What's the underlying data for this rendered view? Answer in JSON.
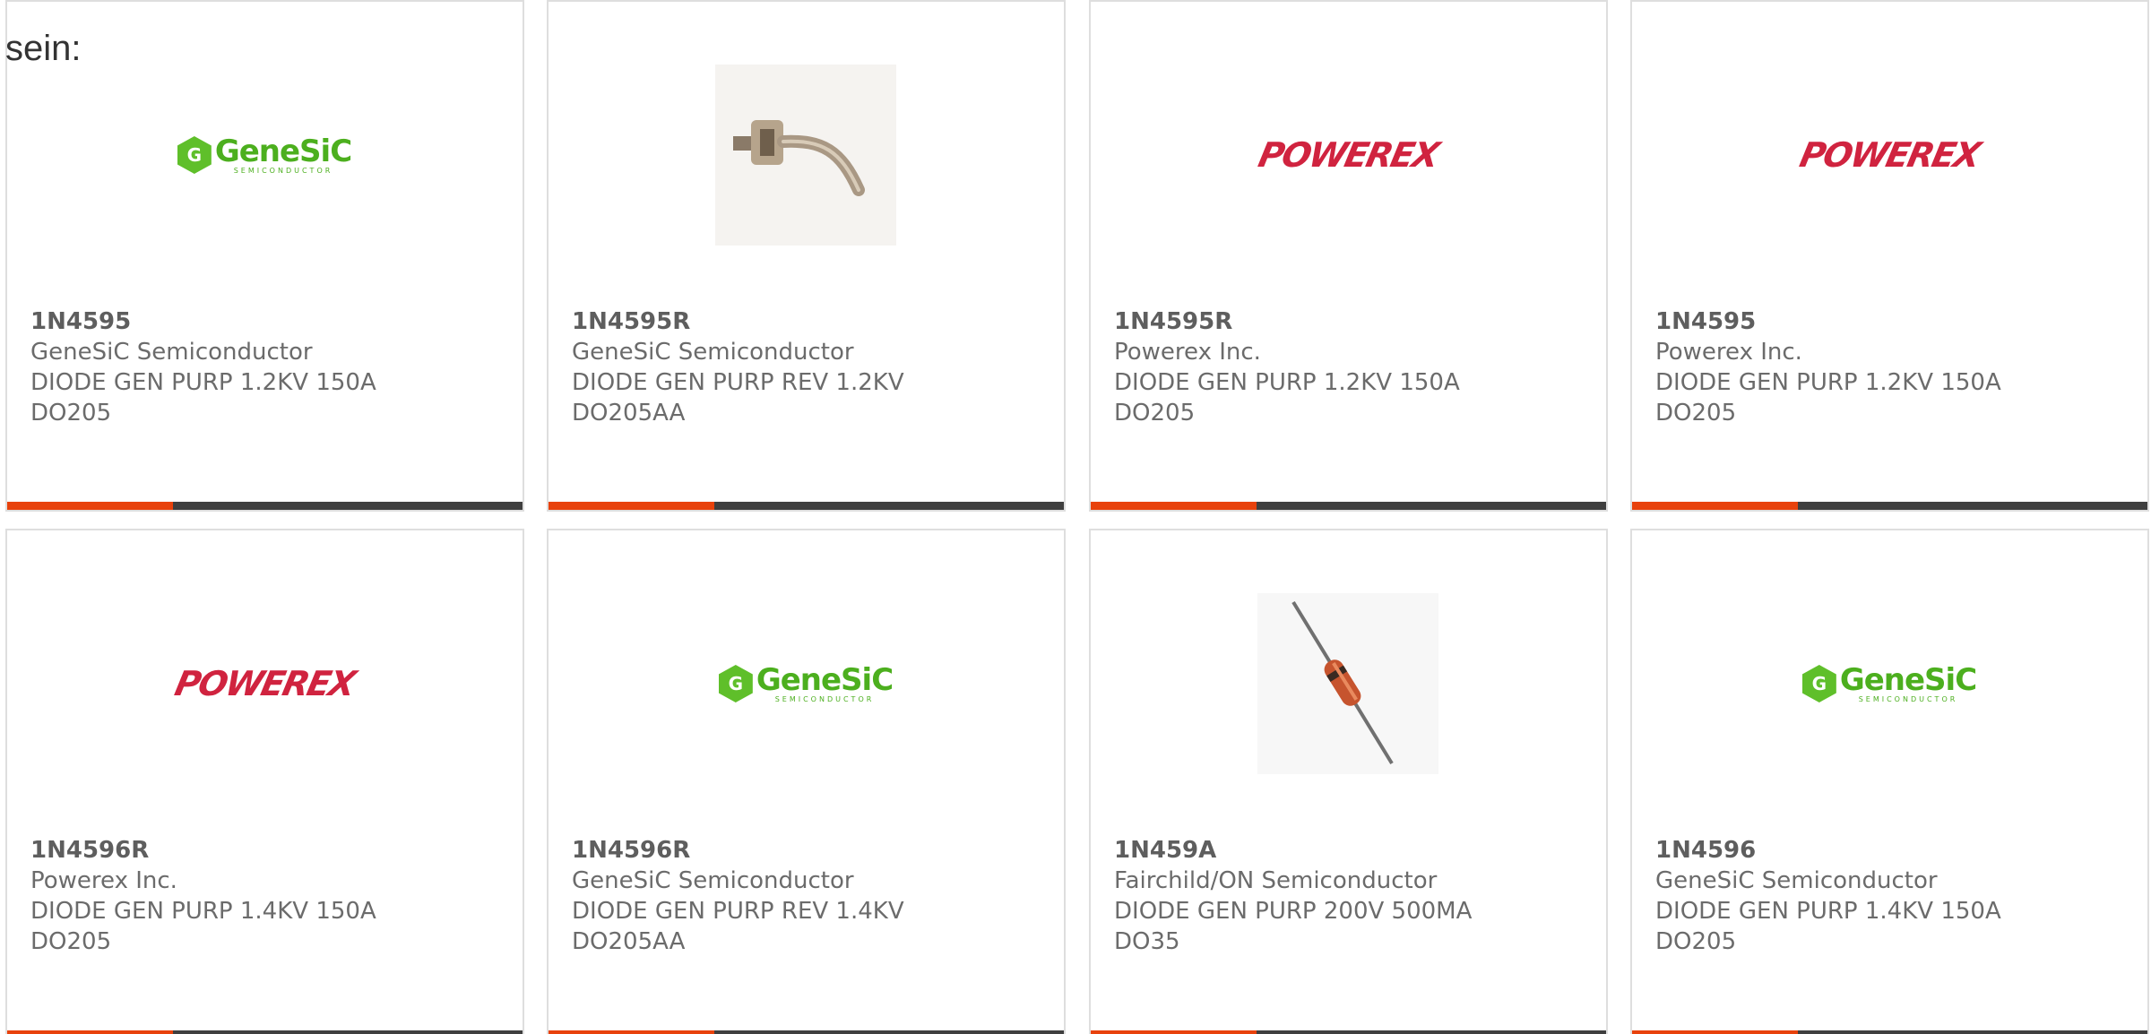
{
  "intro_text": "sein:",
  "colors": {
    "accent": "#e8420c",
    "bar": "#3f3f3f",
    "genesic_green": "#4caf1e",
    "powerex_red": "#d0233f"
  },
  "products": [
    {
      "part": "1N4595",
      "maker": "GeneSiC Semiconductor",
      "desc1": "DIODE GEN PURP 1.2KV 150A",
      "desc2": "DO205",
      "image": "genesic-logo",
      "logo_text": "GeneSiC",
      "logo_sub": "SEMICONDUCTOR"
    },
    {
      "part": "1N4595R",
      "maker": "GeneSiC Semiconductor",
      "desc1": "DIODE GEN PURP REV 1.2KV",
      "desc2": "DO205AA",
      "image": "stud-diode-photo"
    },
    {
      "part": "1N4595R",
      "maker": "Powerex Inc.",
      "desc1": "DIODE GEN PURP 1.2KV 150A",
      "desc2": "DO205",
      "image": "powerex-logo",
      "logo_text": "POWEREX"
    },
    {
      "part": "1N4595",
      "maker": "Powerex Inc.",
      "desc1": "DIODE GEN PURP 1.2KV 150A",
      "desc2": "DO205",
      "image": "powerex-logo",
      "logo_text": "POWEREX"
    },
    {
      "part": "1N4596R",
      "maker": "Powerex Inc.",
      "desc1": "DIODE GEN PURP 1.4KV 150A",
      "desc2": "DO205",
      "image": "powerex-logo",
      "logo_text": "POWEREX"
    },
    {
      "part": "1N4596R",
      "maker": "GeneSiC Semiconductor",
      "desc1": "DIODE GEN PURP REV 1.4KV",
      "desc2": "DO205AA",
      "image": "genesic-logo",
      "logo_text": "GeneSiC",
      "logo_sub": "SEMICONDUCTOR"
    },
    {
      "part": "1N459A",
      "maker": "Fairchild/ON Semiconductor",
      "desc1": "DIODE GEN PURP 200V 500MA",
      "desc2": "DO35",
      "image": "axial-diode-photo"
    },
    {
      "part": "1N4596",
      "maker": "GeneSiC Semiconductor",
      "desc1": "DIODE GEN PURP 1.4KV 150A",
      "desc2": "DO205",
      "image": "genesic-logo",
      "logo_text": "GeneSiC",
      "logo_sub": "SEMICONDUCTOR"
    }
  ]
}
